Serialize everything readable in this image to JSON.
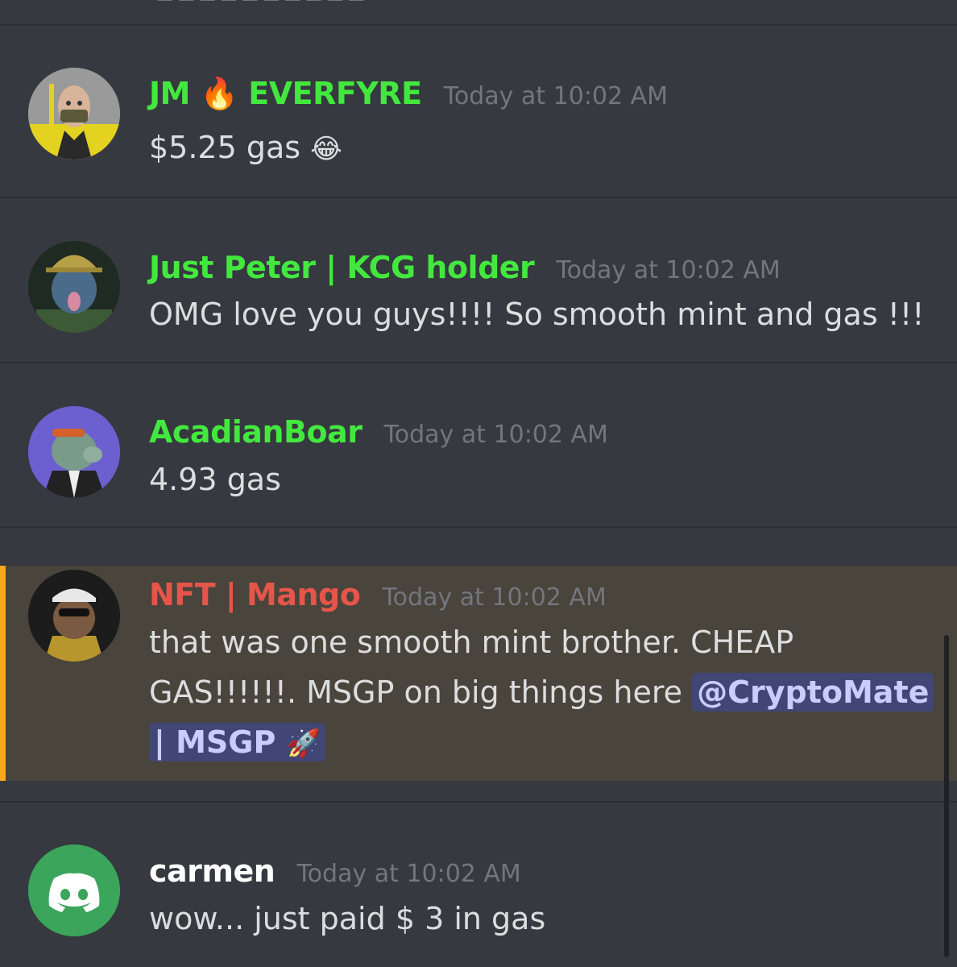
{
  "channel": {
    "top_fragment": "— — — — — — — — — —"
  },
  "messages": [
    {
      "username_part1": "JM",
      "username_emoji": "🔥",
      "username_part2": "EVERFYRE",
      "username_color": "#43e83f",
      "timestamp": "Today at 10:02 AM",
      "text": "$5.25 gas",
      "text_emoji": "😂"
    },
    {
      "username": "Just Peter | KCG holder",
      "username_color": "#43e83f",
      "timestamp": "Today at 10:02 AM",
      "text": "OMG love you guys!!!! So smooth mint and gas !!!"
    },
    {
      "username": "AcadianBoar",
      "username_color": "#43e83f",
      "timestamp": "Today at 10:02 AM",
      "text": "4.93 gas"
    },
    {
      "username": "NFT | Mango",
      "username_color": "#e5554a",
      "timestamp": "Today at 10:02 AM",
      "line1": "that was one smooth mint brother. CHEAP",
      "line2": "GAS!!!!!!.  MSGP on big things here",
      "mention_part1": "@CryptoMate",
      "mention_part2": "| MSGP",
      "mention_emoji": "🚀"
    },
    {
      "username": "carmen",
      "username_color": "#ffffff",
      "timestamp": "Today at 10:02 AM",
      "text": "wow... just paid $ 3 in gas"
    }
  ],
  "colors": {
    "background": "#36393f",
    "mention_highlight": "#49443c",
    "mention_bar": "#faa81a",
    "discord_green": "#3ba55c"
  },
  "icons": {
    "default_avatar": "discord-logo-icon"
  }
}
